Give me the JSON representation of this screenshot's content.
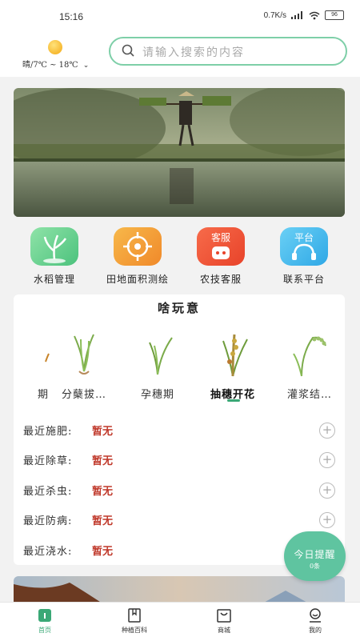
{
  "status": {
    "time": "15:16",
    "speed": "0.7K/s",
    "battery": "96"
  },
  "weather": {
    "text": "晴/7℃ ~ 18℃"
  },
  "search": {
    "placeholder": "请输入搜索的内容"
  },
  "features": [
    {
      "label": "水稻管理"
    },
    {
      "label": "田地面积测绘"
    },
    {
      "label": "农技客服",
      "badge": "客服"
    },
    {
      "label": "联系平台",
      "badge": "平台"
    }
  ],
  "card": {
    "title": "啥玩意",
    "stages": [
      {
        "label": "期"
      },
      {
        "label": "分蘖拔…"
      },
      {
        "label": "孕穗期"
      },
      {
        "label": "抽穗开花"
      },
      {
        "label": "灌浆结…"
      }
    ],
    "rows": [
      {
        "key": "最近施肥:",
        "value": "暂无"
      },
      {
        "key": "最近除草:",
        "value": "暂无"
      },
      {
        "key": "最近杀虫:",
        "value": "暂无"
      },
      {
        "key": "最近防病:",
        "value": "暂无"
      },
      {
        "key": "最近浇水:",
        "value": "暂无"
      }
    ]
  },
  "remind": {
    "title": "今日提醒",
    "count": "0条"
  },
  "tabs": [
    {
      "label": "首页"
    },
    {
      "label": "种植百科"
    },
    {
      "label": "商城"
    },
    {
      "label": "我的"
    }
  ],
  "colors": {
    "accent": "#3aa876",
    "search_border": "#7ecfa8",
    "warn": "#c0392b",
    "remind": "#5fc4a0"
  }
}
